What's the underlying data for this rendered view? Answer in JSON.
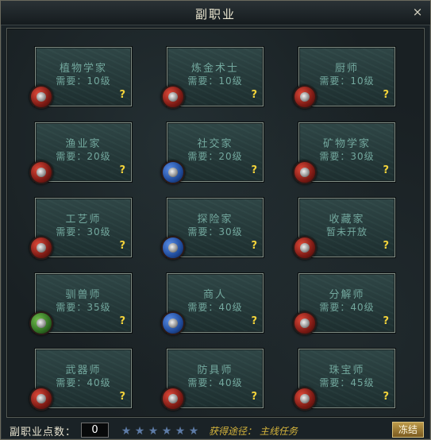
{
  "window": {
    "title": "副职业",
    "close_glyph": "×"
  },
  "help_glyph": "?",
  "professions": [
    {
      "name": "植物学家",
      "requirement": "需要：10级",
      "emblem": "red"
    },
    {
      "name": "炼金术士",
      "requirement": "需要：10级",
      "emblem": "red"
    },
    {
      "name": "厨师",
      "requirement": "需要：10级",
      "emblem": "red"
    },
    {
      "name": "渔业家",
      "requirement": "需要：20级",
      "emblem": "red"
    },
    {
      "name": "社交家",
      "requirement": "需要：20级",
      "emblem": "blue"
    },
    {
      "name": "矿物学家",
      "requirement": "需要：30级",
      "emblem": "red"
    },
    {
      "name": "工艺师",
      "requirement": "需要：30级",
      "emblem": "red"
    },
    {
      "name": "探险家",
      "requirement": "需要：30级",
      "emblem": "blue"
    },
    {
      "name": "收藏家",
      "requirement": "暂未开放",
      "emblem": "red"
    },
    {
      "name": "驯兽师",
      "requirement": "需要：35级",
      "emblem": "green"
    },
    {
      "name": "商人",
      "requirement": "需要：40级",
      "emblem": "blue"
    },
    {
      "name": "分解师",
      "requirement": "需要：40级",
      "emblem": "red"
    },
    {
      "name": "武器师",
      "requirement": "需要：40级",
      "emblem": "red"
    },
    {
      "name": "防具师",
      "requirement": "需要：40级",
      "emblem": "red"
    },
    {
      "name": "珠宝师",
      "requirement": "需要：45级",
      "emblem": "red"
    }
  ],
  "footer": {
    "points_label": "副职业点数：",
    "points_value": "0",
    "stars": [
      "★",
      "★",
      "★",
      "★",
      "★",
      "★"
    ],
    "acquire_label": "获得途径：",
    "acquire_value": "主线任务",
    "freeze_label": "冻结"
  },
  "colors": {
    "help": "#f2d23a",
    "card_text": "#73a89e",
    "acquire": "#d6b53c"
  }
}
